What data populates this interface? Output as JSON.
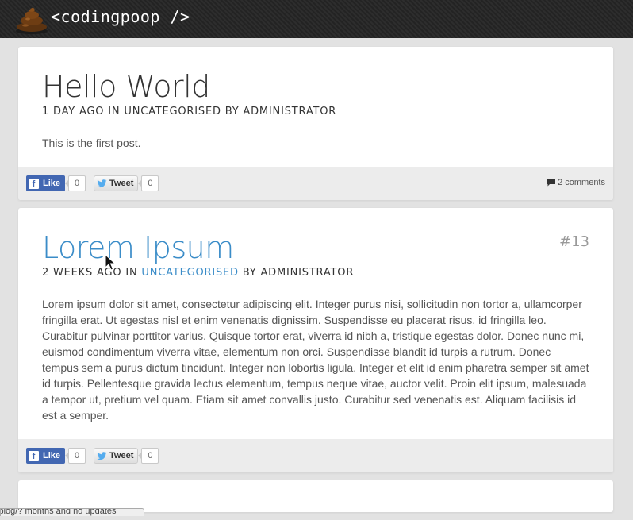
{
  "site": {
    "logo_text": "<codingpoop />"
  },
  "posts": [
    {
      "title": "Hello World",
      "meta": {
        "time": "1 day ago",
        "in_word": "in",
        "category": "Uncategorised",
        "by_word": "by",
        "author": "Administrator"
      },
      "body": "This is the first post.",
      "like_label": "Like",
      "like_count": "0",
      "tweet_label": "Tweet",
      "tweet_count": "0",
      "comments": "2 comments"
    },
    {
      "title": "Lorem Ipsum",
      "number": "#13",
      "meta": {
        "time": "2 weeks ago",
        "in_word": "in",
        "category": "Uncategorised",
        "by_word": "by",
        "author": "Administrator"
      },
      "body": "Lorem ipsum dolor sit amet, consectetur adipiscing elit. Integer purus nisi, sollicitudin non tortor a, ullamcorper fringilla erat. Ut egestas nisl et enim venenatis dignissim. Suspendisse eu placerat risus, id fringilla leo. Curabitur pulvinar porttitor varius. Quisque tortor erat, viverra id nibh a, tristique egestas dolor. Donec nunc mi, euismod condimentum viverra vitae, elementum non orci. Suspendisse blandit id turpis a rutrum. Donec tempus sem a purus dictum tincidunt. Integer non lobortis ligula. Integer et elit id enim pharetra semper sit amet id turpis. Pellentesque gravida lectus elementum, tempus neque vitae, auctor velit. Proin elit ipsum, malesuada a tempor ut, pretium vel quam. Etiam sit amet convallis justo. Curabitur sed venenatis est. Aliquam facilisis id est a semper.",
      "like_label": "Like",
      "like_count": "0",
      "tweet_label": "Tweet",
      "tweet_count": "0"
    }
  ],
  "status_bar": {
    "text": "vblog/? months and no updates"
  },
  "colors": {
    "link": "#3a8cc8",
    "facebook": "#4267b2",
    "twitter": "#55acee",
    "header": "#262626"
  },
  "icons": {
    "logo": "poop-icon",
    "facebook": "facebook-f-icon",
    "twitter": "twitter-bird-icon",
    "comments": "comment-bubble-icon",
    "cursor": "mouse-pointer-icon"
  }
}
